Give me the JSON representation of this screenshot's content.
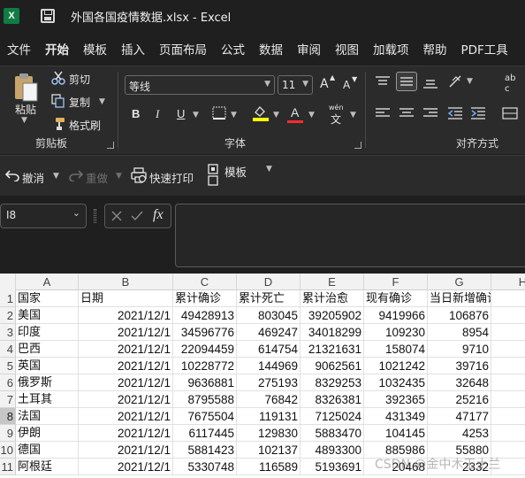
{
  "app": {
    "logo_text": "X",
    "title": "外国各国疫情数据.xlsx  -  Excel"
  },
  "menu": {
    "tabs": [
      "文件",
      "开始",
      "模板",
      "插入",
      "页面布局",
      "公式",
      "数据",
      "审阅",
      "视图",
      "加载项",
      "帮助",
      "PDF工具"
    ]
  },
  "ribbon": {
    "clipboard": {
      "paste": "粘贴",
      "cut": "剪切",
      "copy": "复制",
      "format_painter": "格式刷",
      "group_label": "剪贴板"
    },
    "font": {
      "font_name": "等线",
      "font_size": "11",
      "grow": "A",
      "shrink": "A",
      "bold": "B",
      "italic": "I",
      "underline": "U",
      "font_color_glyph": "A",
      "phonetic": "wén",
      "phonetic2": "文",
      "group_label": "字体"
    },
    "alignment": {
      "group_label": "对齐方式",
      "wrap_top": "ab",
      "wrap_bottom": "c"
    }
  },
  "quickbar": {
    "undo": "撤消",
    "redo": "重做",
    "quick_print": "快速打印",
    "template": "模板"
  },
  "formula": {
    "name_box": "I8",
    "fx": "fx",
    "content": ""
  },
  "sheet": {
    "columns": [
      "A",
      "B",
      "C",
      "D",
      "E",
      "F",
      "G",
      "H"
    ],
    "row_numbers": [
      "1",
      "2",
      "3",
      "4",
      "5",
      "6",
      "7",
      "8",
      "9",
      "10",
      "11"
    ],
    "selected_row": "8",
    "headers": [
      "国家",
      "日期",
      "累计确诊",
      "累计死亡",
      "累计治愈",
      "现有确诊",
      "当日新增确诊"
    ],
    "rows": [
      [
        "美国",
        "2021/12/1",
        "49428913",
        "803045",
        "39205902",
        "9419966",
        "106876"
      ],
      [
        "印度",
        "2021/12/1",
        "34596776",
        "469247",
        "34018299",
        "109230",
        "8954"
      ],
      [
        "巴西",
        "2021/12/1",
        "22094459",
        "614754",
        "21321631",
        "158074",
        "9710"
      ],
      [
        "英国",
        "2021/12/1",
        "10228772",
        "144969",
        "9062561",
        "1021242",
        "39716"
      ],
      [
        "俄罗斯",
        "2021/12/1",
        "9636881",
        "275193",
        "8329253",
        "1032435",
        "32648"
      ],
      [
        "土耳其",
        "2021/12/1",
        "8795588",
        "76842",
        "8326381",
        "392365",
        "25216"
      ],
      [
        "法国",
        "2021/12/1",
        "7675504",
        "119131",
        "7125024",
        "431349",
        "47177"
      ],
      [
        "伊朗",
        "2021/12/1",
        "6117445",
        "129830",
        "5883470",
        "104145",
        "4253"
      ],
      [
        "德国",
        "2021/12/1",
        "5881423",
        "102137",
        "4893300",
        "885986",
        "55880"
      ],
      [
        "阿根廷",
        "2021/12/1",
        "5330748",
        "116589",
        "5193691",
        "20468",
        "2332"
      ]
    ]
  },
  "watermark": "CSDN @金中木玉土兰"
}
